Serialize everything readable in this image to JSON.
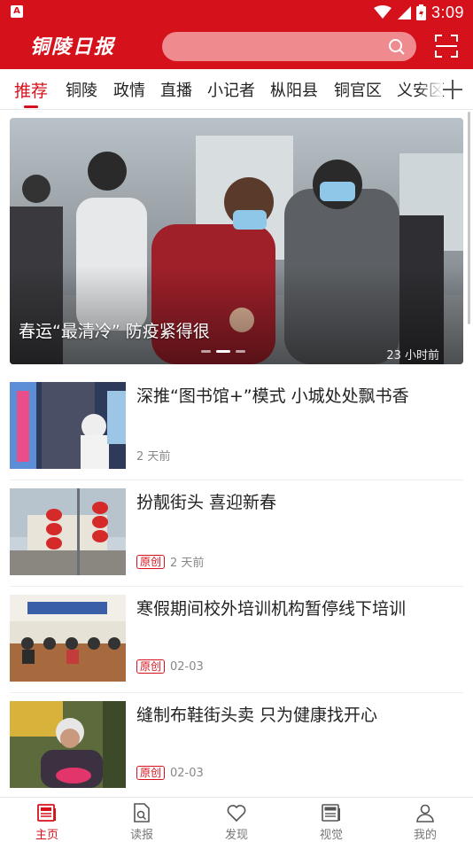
{
  "colors": {
    "brand_red": "#d5121c",
    "search_bg": "#ef8a8f",
    "meta_gray": "#888888"
  },
  "status_bar": {
    "time": "3:09",
    "left_icon": "A"
  },
  "app_bar": {
    "logo_text": "铜陵日报",
    "search_placeholder": ""
  },
  "tabs": [
    {
      "label": "推荐",
      "active": true
    },
    {
      "label": "铜陵"
    },
    {
      "label": "政情"
    },
    {
      "label": "直播"
    },
    {
      "label": "小记者"
    },
    {
      "label": "枞阳县"
    },
    {
      "label": "铜官区"
    },
    {
      "label": "义安区"
    }
  ],
  "banner": {
    "title": "春运“最清冷” 防疫紧得很",
    "time": "23 小时前",
    "slides": 3,
    "active_slide": 2
  },
  "news": [
    {
      "title": "深推“图书馆+”模式 小城处处飘书香",
      "tag": "",
      "time": "2 天前"
    },
    {
      "title": "扮靓街头 喜迎新春",
      "tag": "原创",
      "time": "2 天前"
    },
    {
      "title": "寒假期间校外培训机构暂停线下培训",
      "tag": "原创",
      "time": "02-03"
    },
    {
      "title": "缝制布鞋街头卖 只为健康找开心",
      "tag": "原创",
      "time": "02-03"
    }
  ],
  "bottom_nav": [
    {
      "label": "主页",
      "icon": "newspaper-icon",
      "active": true
    },
    {
      "label": "读报",
      "icon": "read-paper-icon"
    },
    {
      "label": "发现",
      "icon": "heart-icon"
    },
    {
      "label": "视觉",
      "icon": "news-icon"
    },
    {
      "label": "我的",
      "icon": "person-icon"
    }
  ]
}
